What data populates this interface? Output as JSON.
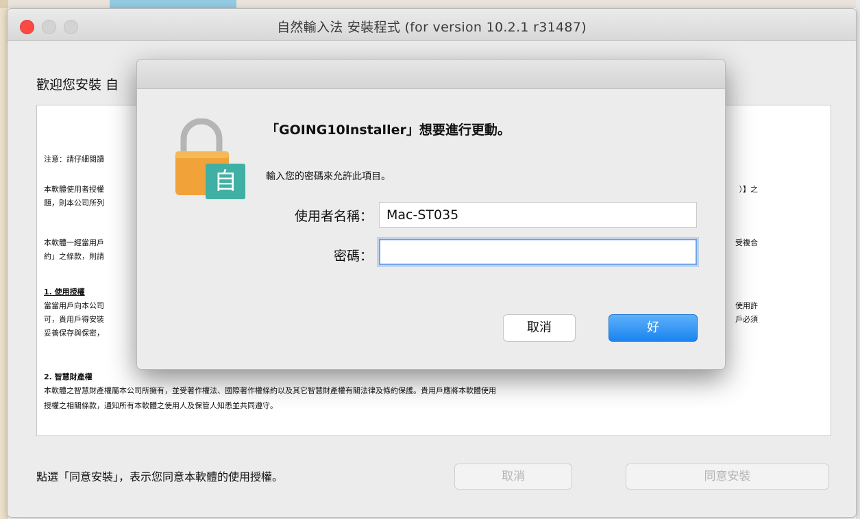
{
  "window": {
    "title": "自然輸入法 安裝程式 (for version 10.2.1 r31487)",
    "welcome": "歡迎您安裝 自",
    "license_left": [
      "注意：請仔細閱讀",
      "本軟體使用者授權",
      "題，則本公司所列",
      "本軟體一經當用戶",
      "約」之條款，則請",
      "1. 使用授權",
      "當當用戶向本公司",
      "可，貴用戶得安裝",
      "妥善保存與保密，",
      "2. 智慧財產權",
      "本軟體之智慧財產權屬本公司所擁有，並受著作權法、國際著作權條約以及其它智慧財產權有關法律及條約保護。貴用戶應將本軟體使用",
      "授權之相關條款，通知所有本軟體之使用人及保管人知悉並共同遵守。"
    ],
    "license_right": [
      "）】之",
      "受複合",
      "使用許",
      "戶必須"
    ],
    "footer_text": "點選「同意安裝」，表示您同意本軟體的使用授權。",
    "cancel_button": "取消",
    "agree_button": "同意安裝"
  },
  "dialog": {
    "title": "「GOING10Installer」想要進行更動。",
    "subtitle": "輸入您的密碼來允許此項目。",
    "username_label": "使用者名稱：",
    "username_value": "Mac-ST035",
    "password_label": "密碼：",
    "password_value": "",
    "cancel_button": "取消",
    "ok_button": "好",
    "icon": "lock-icon",
    "badge_char": "自"
  },
  "colors": {
    "accent": "#1a84f0",
    "lock_gold": "#f1a33a",
    "badge_teal": "#3fb0a3",
    "close_red": "#fc4a42"
  }
}
